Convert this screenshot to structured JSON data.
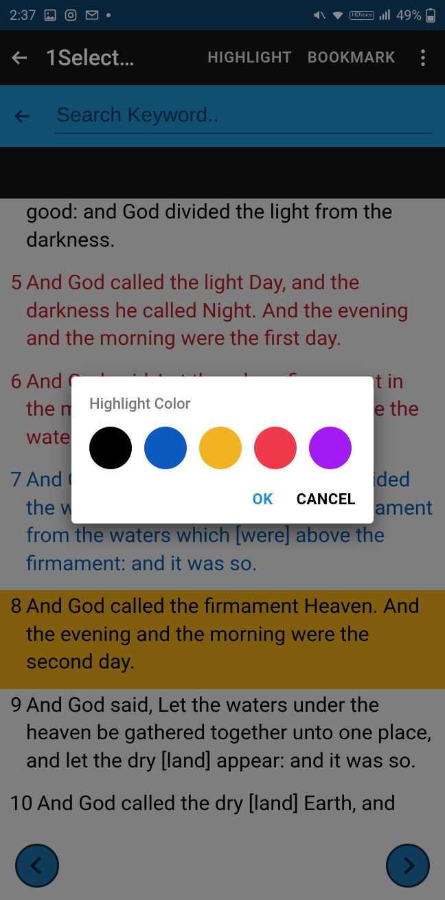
{
  "status": {
    "time": "2:37",
    "battery": "49%"
  },
  "appbar": {
    "title": "1Select…",
    "highlight": "HIGHLIGHT",
    "bookmark": "BOOKMARK"
  },
  "search": {
    "placeholder": "Search Keyword.."
  },
  "verses": [
    {
      "num": "",
      "text": "good: and God divided the light from the darkness.",
      "cls": "first"
    },
    {
      "num": "5",
      "text": "And God called the light Day, and the darkness he called Night. And the evening and the morning were the first day.",
      "cls": "red"
    },
    {
      "num": "6",
      "text": "And God said, Let there be a firmament in the midst of the waters, and let it divide the waters from the waters.",
      "cls": "red"
    },
    {
      "num": "7",
      "text": "And God made the firmament, and divided the waters which [were] under the firmament from the waters which [were] above the firmament: and it was so.",
      "cls": "blue"
    },
    {
      "num": "8",
      "text": "And God called the firmament Heaven. And the evening and the morning were the second day.",
      "cls": "yellow-bg"
    },
    {
      "num": "9",
      "text": "And God said, Let the waters under the heaven be gathered together unto one place, and let the dry [land] appear: and it was so.",
      "cls": ""
    },
    {
      "num": "10",
      "text": "And God called the dry [land] Earth, and",
      "cls": ""
    }
  ],
  "dialog": {
    "title": "Highlight Color",
    "colors": [
      "#000000",
      "#0b5bbf",
      "#f1b322",
      "#ef3a4a",
      "#a21bf4"
    ],
    "color_names": [
      "black",
      "blue",
      "yellow",
      "red",
      "purple"
    ],
    "ok": "OK",
    "cancel": "CANCEL"
  }
}
